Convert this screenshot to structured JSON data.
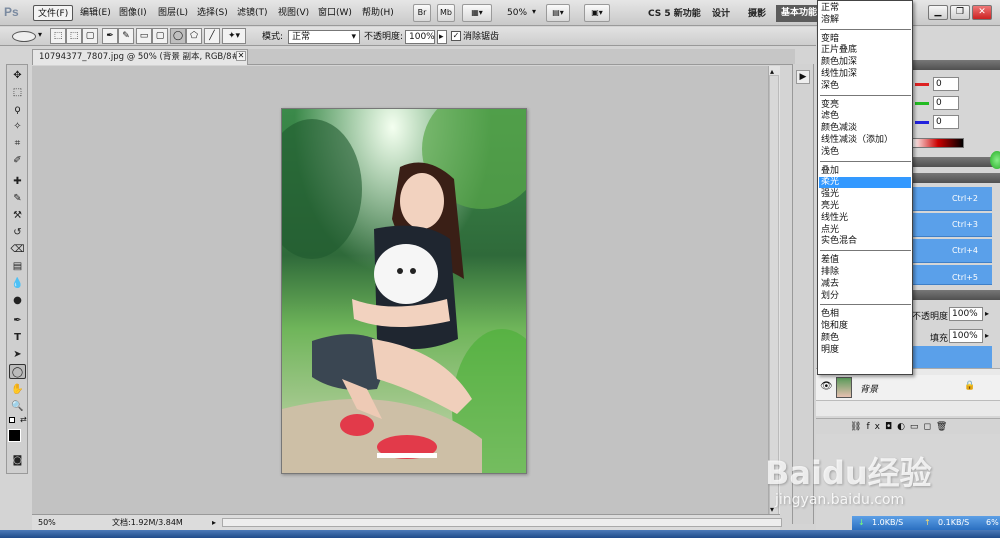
{
  "app": {
    "logo": "Ps"
  },
  "menubar": {
    "items": [
      "文件(F)",
      "编辑(E)",
      "图像(I)",
      "图层(L)",
      "选择(S)",
      "滤镜(T)",
      "视图(V)",
      "窗口(W)",
      "帮助(H)"
    ],
    "toolbar_buttons": [
      "Br",
      "Mb"
    ],
    "zoom": "50%",
    "workspaces": [
      "CS 5 新功能",
      "设计",
      "摄影"
    ],
    "active_workspace": "基本功能"
  },
  "options": {
    "mode_label": "模式:",
    "mode_value": "正常",
    "opacity_label": "不透明度:",
    "opacity_value": "100%",
    "antialias_label": "消除锯齿"
  },
  "document": {
    "tab_title": "10794377_7807.jpg @ 50% (背景 副本, RGB/8#) *",
    "zoom": "50%",
    "doc_info": "文档:1.92M/3.84M"
  },
  "blend_dropdown": {
    "groups": [
      [
        "正常",
        "溶解"
      ],
      [
        "变暗",
        "正片叠底",
        "颜色加深",
        "线性加深",
        "深色"
      ],
      [
        "变亮",
        "滤色",
        "颜色减淡",
        "线性减淡（添加）",
        "浅色"
      ],
      [
        "叠加",
        "柔光",
        "强光",
        "亮光",
        "线性光",
        "点光",
        "实色混合"
      ],
      [
        "差值",
        "排除",
        "减去",
        "划分"
      ],
      [
        "色相",
        "饱和度",
        "颜色",
        "明度"
      ]
    ],
    "highlighted": "柔光"
  },
  "color_panel": {
    "r": "0",
    "g": "0",
    "b": "0"
  },
  "actions_panel": {
    "shortcuts": [
      "Ctrl+2",
      "Ctrl+3",
      "Ctrl+4",
      "Ctrl+5"
    ]
  },
  "layers_panel": {
    "opacity_label": "不透明度:",
    "opacity_value": "100%",
    "fill_label": "填充:",
    "fill_value": "100%",
    "layer_name": "背景"
  },
  "watermark": {
    "text": "Baidu经验",
    "url": "jingyan.baidu.com"
  },
  "network": {
    "down": "1.0KB/S",
    "up": "0.1KB/S",
    "cpu": "6%"
  },
  "colors": {
    "highlight": "#3399ff",
    "panel_select": "#5aa0ea"
  }
}
